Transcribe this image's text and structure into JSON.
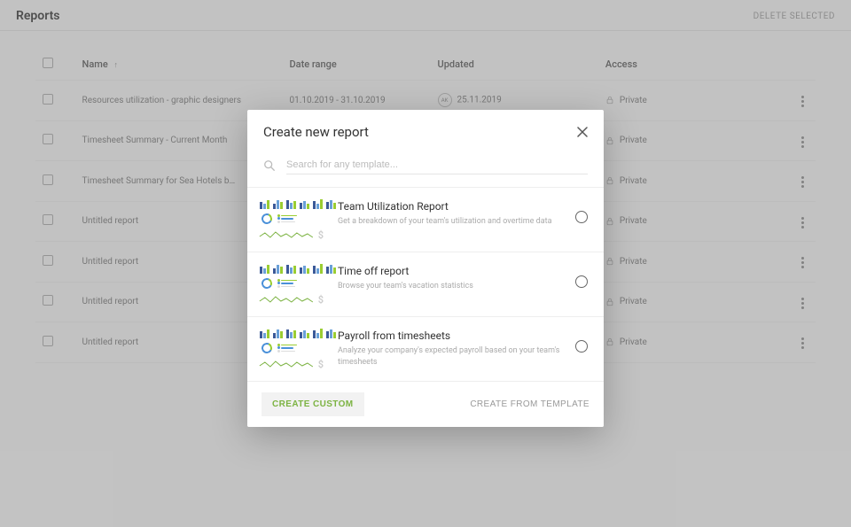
{
  "header": {
    "title": "Reports",
    "delete_selected": "DELETE SELECTED"
  },
  "table": {
    "columns": {
      "name": "Name",
      "date_range": "Date range",
      "updated": "Updated",
      "access": "Access"
    },
    "rows": [
      {
        "name": "Resources utilization - graphic designers",
        "date_range": "01.10.2019 - 31.10.2019",
        "avatar": "AK",
        "updated": "25.11.2019",
        "access": "Private"
      },
      {
        "name": "Timesheet Summary - Current Month",
        "date_range": "",
        "avatar": "",
        "updated": "",
        "access": "Private"
      },
      {
        "name": "Timesheet Summary for Sea Hotels b…",
        "date_range": "",
        "avatar": "",
        "updated": "",
        "access": "Private"
      },
      {
        "name": "Untitled report",
        "date_range": "",
        "avatar": "",
        "updated": "",
        "access": "Private"
      },
      {
        "name": "Untitled report",
        "date_range": "",
        "avatar": "",
        "updated": "",
        "access": "Private"
      },
      {
        "name": "Untitled report",
        "date_range": "",
        "avatar": "",
        "updated": "",
        "access": "Private"
      },
      {
        "name": "Untitled report",
        "date_range": "",
        "avatar": "",
        "updated": "",
        "access": "Private"
      }
    ]
  },
  "modal": {
    "title": "Create new report",
    "search_placeholder": "Search for any template...",
    "templates": [
      {
        "title": "Team Utilization Report",
        "desc": "Get a breakdown of your team's utilization and overtime data"
      },
      {
        "title": "Time off report",
        "desc": "Browse your team's vacation statistics"
      },
      {
        "title": "Payroll from timesheets",
        "desc": "Analyze your company's expected payroll based on your team's timesheets"
      }
    ],
    "create_custom": "CREATE CUSTOM",
    "create_from_template": "CREATE FROM TEMPLATE"
  },
  "icons": {
    "dollar": "$"
  }
}
